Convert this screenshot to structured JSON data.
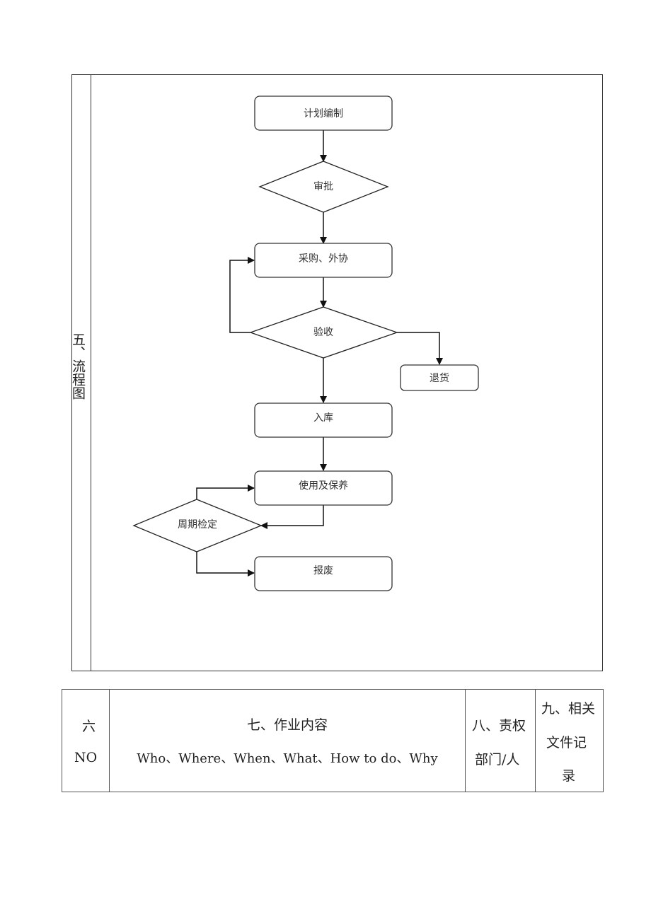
{
  "flowchart_section": {
    "label": "五、流程图",
    "nodes": {
      "plan": "计划编制",
      "approve": "审批",
      "purchase": "采购、外协",
      "inspect": "验收",
      "return": "退货",
      "store": "入库",
      "use": "使用及保养",
      "calibrate": "周期检定",
      "scrap": "报废"
    }
  },
  "table_header": {
    "col1_line1": "六",
    "col1_line2": "NO",
    "col2_line1": "七、作业内容",
    "col2_line2": "Who、Where、When、What、How  to  do、Why",
    "col3_line1": "八、责权",
    "col3_line2": "部门/人",
    "col4_line1": "九、相关",
    "col4_line2": "文件记",
    "col4_line3": "录"
  }
}
